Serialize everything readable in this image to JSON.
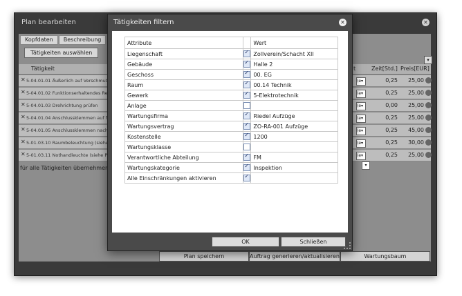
{
  "outer": {
    "title": "Plan bearbeiten",
    "tabs": [
      "Kopfdaten",
      "Beschreibung"
    ],
    "select_button": "Tätigkeiten auswählen",
    "column_activity": "Tätigkeit",
    "rows": [
      {
        "text": "5-04.01.01 Äußerlich auf Verschmut",
        "zeit": "0,25",
        "preis": "25,00"
      },
      {
        "text": "5-04.01.02 Funktionserhaltendes Re",
        "zeit": "0,25",
        "preis": "25,00"
      },
      {
        "text": "5-04.01.03 Drehrichtung prüfen",
        "zeit": "0,00",
        "preis": "25,00"
      },
      {
        "text": "5-04.01.04 Anschlussklemmen auf f",
        "zeit": "0,25",
        "preis": "25,00"
      },
      {
        "text": "5-04.01.05 Anschlussklemmen nach",
        "zeit": "0,25",
        "preis": "45,00"
      },
      {
        "text": "5-01.03.10 Raumbeleuchtung (siehe",
        "zeit": "0,25",
        "preis": "30,00"
      },
      {
        "text": "5-01.03.11 Nothandleuchte (siehe P",
        "zeit": "0,25",
        "preis": "25,00"
      }
    ],
    "for_all": "für alle Tätigkeiten übernehmen",
    "col_t": "t",
    "col_zeit": "Zeit[Std.]",
    "col_preis": "Preis[EUR]",
    "select_value": "(e",
    "buttons": {
      "save": "Plan speichern",
      "generate": "Auftrag generieren/aktualisieren",
      "tree": "Wartungsbaum"
    }
  },
  "modal": {
    "title": "Tätigkeiten filtern",
    "col_attribute": "Attribute",
    "col_value": "Wert",
    "rows": [
      {
        "attribute": "Liegenschaft",
        "checked": true,
        "value": "Zollverein/Schacht XII"
      },
      {
        "attribute": "Gebäude",
        "checked": true,
        "value": "Halle 2"
      },
      {
        "attribute": "Geschoss",
        "checked": true,
        "value": "00. EG"
      },
      {
        "attribute": "Raum",
        "checked": true,
        "value": "00.14 Technik"
      },
      {
        "attribute": "Gewerk",
        "checked": true,
        "value": "5-Elektrotechnik"
      },
      {
        "attribute": "Anlage",
        "checked": false,
        "value": ""
      },
      {
        "attribute": "Wartungsfirma",
        "checked": true,
        "value": "Riedel Aufzüge"
      },
      {
        "attribute": "Wartungsvertrag",
        "checked": true,
        "value": "ZO-RA-001 Aufzüge"
      },
      {
        "attribute": "Kostenstelle",
        "checked": true,
        "value": "1200"
      },
      {
        "attribute": "Wartungsklasse",
        "checked": false,
        "value": ""
      },
      {
        "attribute": "Verantwortliche Abteilung",
        "checked": true,
        "value": "FM"
      },
      {
        "attribute": "Wartungskategorie",
        "checked": true,
        "value": "Inspektion"
      },
      {
        "attribute": "Alle Einschränkungen aktivieren",
        "checked": true,
        "value": ""
      }
    ],
    "ok": "OK",
    "close": "Schließen"
  }
}
